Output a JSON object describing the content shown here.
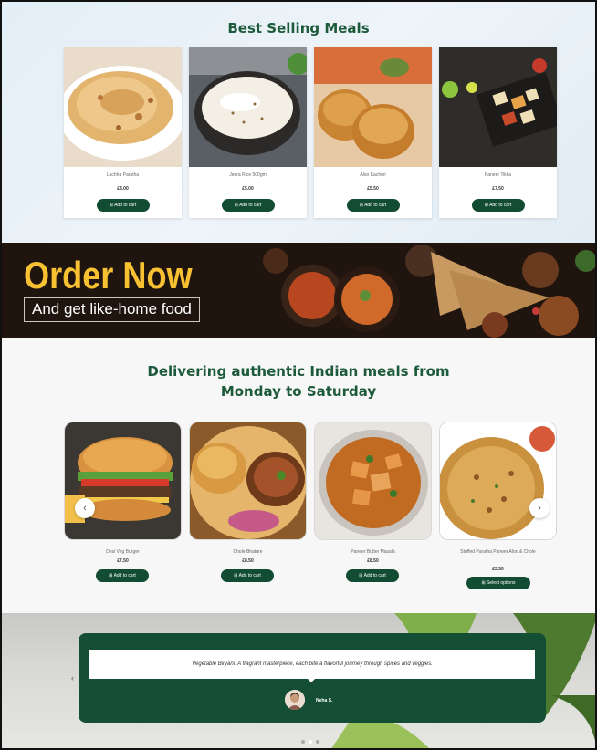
{
  "best_selling": {
    "title": "Best Selling Meals",
    "items": [
      {
        "name": "Lachha Paratha",
        "price": "£3.00",
        "button": "Add to cart"
      },
      {
        "name": "Jeera Rice 500gm",
        "price": "£5.00",
        "button": "Add to cart"
      },
      {
        "name": "Aloo Kachori",
        "price": "£5.50",
        "button": "Add to cart"
      },
      {
        "name": "Paneer Tikka",
        "price": "£7.50",
        "button": "Add to cart"
      }
    ]
  },
  "banner": {
    "headline": "Order Now",
    "subline": "And get like-home food"
  },
  "delivering": {
    "title_line1": "Delivering authentic Indian meals from",
    "title_line2": "Monday to Saturday",
    "items": [
      {
        "name": "Desi Veg Burger",
        "price": "£7.50",
        "button": "Add to cart"
      },
      {
        "name": "Chole Bhature",
        "price": "£8.50",
        "button": "Add to cart"
      },
      {
        "name": "Paneer Butter Masala",
        "price": "£8.50",
        "button": "Add to cart"
      },
      {
        "name": "Stuffed Paratha Paneer Aloo & Chole",
        "price": "£3.50",
        "button": "Select options"
      }
    ]
  },
  "testimonial": {
    "quote": "Vegetable Biryani: A fragrant masterpiece, each bite a flavorful journey through spices and veggies.",
    "author": "Neha S."
  },
  "colors": {
    "brand_green": "#124d33",
    "title_green": "#1c5a3a",
    "banner_yellow": "#f7c131"
  },
  "icons": {
    "cart": "cart-icon",
    "prev": "chevron-left-icon",
    "next": "chevron-right-icon"
  }
}
